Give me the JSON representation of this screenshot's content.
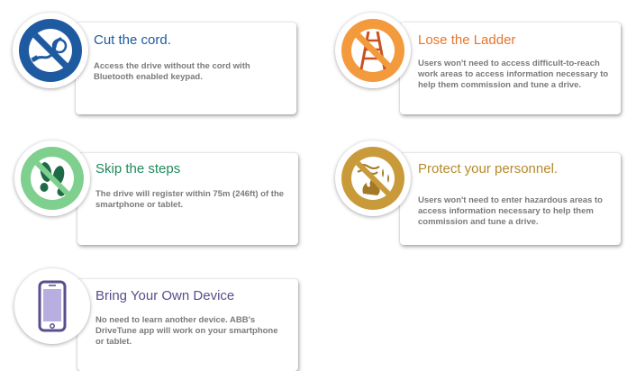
{
  "features": [
    {
      "title": "Cut the cord.",
      "description": "Access the drive without the cord with Bluetooth enabled keypad.",
      "icon": "no-cord-icon",
      "color": "#1e5aa0"
    },
    {
      "title": "Lose the Ladder",
      "description": "Users won't need to access difficult-to-reach work areas to access information necessary to help them commission and tune a drive.",
      "icon": "no-ladder-icon",
      "color": "#e8742a"
    },
    {
      "title": "Skip the steps",
      "description": "The drive will register within 75m (246ft) of the smartphone or tablet.",
      "icon": "footsteps-icon",
      "color": "#1f8a5a"
    },
    {
      "title": "Protect your personnel.",
      "description": "Users won't need to enter hazardous areas to access information necessary to help them commission and tune a drive.",
      "icon": "no-hazard-icon",
      "color": "#b58a2a"
    },
    {
      "title": "Bring Your Own Device",
      "description": "No need to learn another device. ABB's DriveTune app will work on your smartphone or tablet.",
      "icon": "smartphone-icon",
      "color": "#5a4e8c"
    }
  ]
}
